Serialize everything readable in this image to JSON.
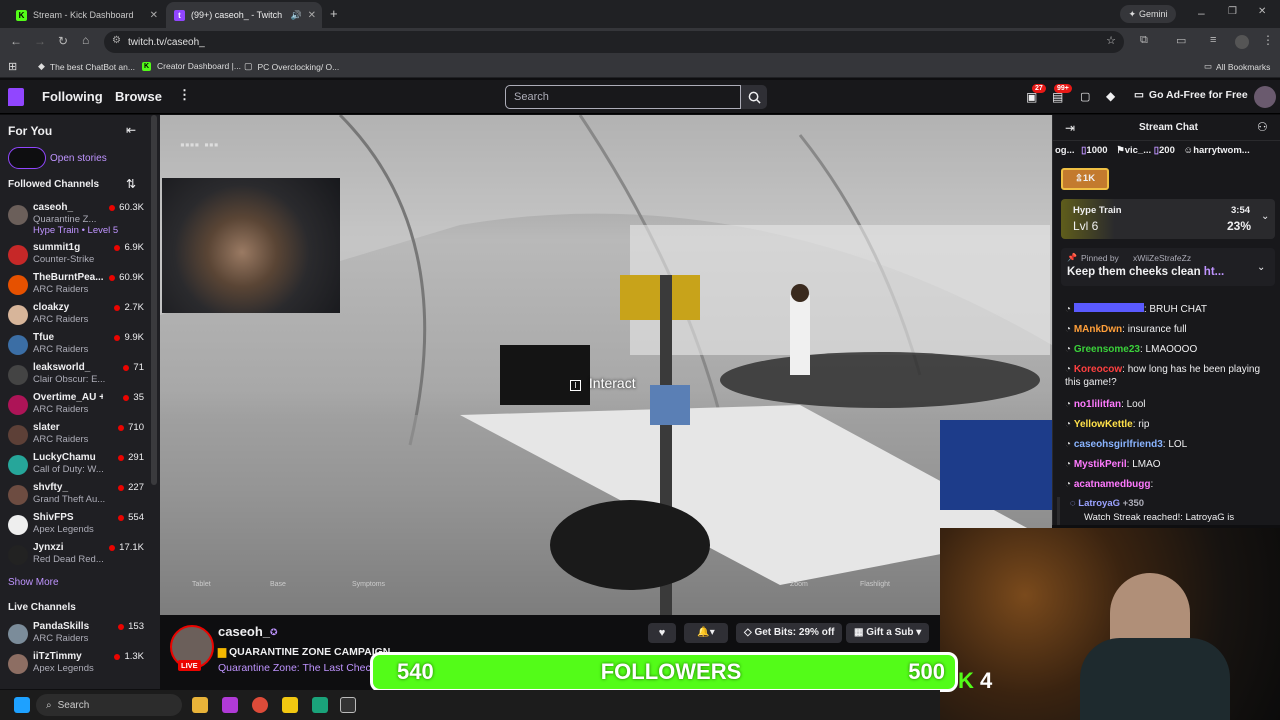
{
  "browser": {
    "tabs": [
      {
        "label": "Stream - Kick Dashboard",
        "active": false
      },
      {
        "label": "(99+) caseoh_ - Twitch",
        "active": true
      }
    ],
    "new_tab": "+",
    "gemini": "Gemini",
    "url": "twitch.tv/caseoh_",
    "bookmarks": [
      "The best ChatBot an...",
      "Creator Dashboard |...",
      "PC Overclocking/ O..."
    ],
    "all_bookmarks": "All Bookmarks"
  },
  "twitch_nav": {
    "following": "Following",
    "browse": "Browse",
    "search_placeholder": "Search",
    "inbox_badge": "27",
    "notifications_badge": "99+",
    "ad_free": "Go Ad-Free for Free"
  },
  "sidebar": {
    "for_you": "For You",
    "open_stories": "Open stories",
    "followed_channels": "Followed Channels",
    "channels": [
      {
        "name": "caseoh_",
        "game": "Quarantine Z...",
        "viewers": "60.3K",
        "extra": "Hype Train • Level 5",
        "color": "#6b5f5a"
      },
      {
        "name": "summit1g",
        "game": "Counter-Strike",
        "viewers": "6.9K",
        "color": "#c62828"
      },
      {
        "name": "TheBurntPea...",
        "game": "ARC Raiders",
        "viewers": "60.9K",
        "color": "#e65100"
      },
      {
        "name": "cloakzy",
        "game": "ARC Raiders",
        "viewers": "2.7K",
        "color": "#d7b59a"
      },
      {
        "name": "Tfue",
        "game": "ARC Raiders",
        "viewers": "9.9K",
        "color": "#3b6ea5"
      },
      {
        "name": "leaksworld_",
        "game": "Clair Obscur: E...",
        "viewers": "71",
        "color": "#444"
      },
      {
        "name": "Overtime_AU +1",
        "game": "ARC Raiders",
        "viewers": "35",
        "color": "#ad1457"
      },
      {
        "name": "slater",
        "game": "ARC Raiders",
        "viewers": "710",
        "color": "#5d4037"
      },
      {
        "name": "LuckyChamu",
        "game": "Call of Duty: W...",
        "viewers": "291",
        "color": "#26a69a"
      },
      {
        "name": "shvfty_",
        "game": "Grand Theft Au...",
        "viewers": "227",
        "color": "#6d4c41"
      },
      {
        "name": "ShivFPS",
        "game": "Apex Legends",
        "viewers": "554",
        "color": "#eee"
      },
      {
        "name": "Jynxzi",
        "game": "Red Dead Red...",
        "viewers": "17.1K",
        "color": "#222"
      }
    ],
    "show_more": "Show More",
    "live_channels": "Live Channels",
    "live": [
      {
        "name": "PandaSkills",
        "game": "ARC Raiders",
        "viewers": "153",
        "color": "#7b8c9a"
      },
      {
        "name": "iiTzTimmy",
        "game": "Apex Legends",
        "viewers": "1.3K",
        "color": "#8d6e63"
      }
    ]
  },
  "video": {
    "interact_prompt": "Interact",
    "hud": [
      "Tablet",
      "Base",
      "Symptoms",
      "Zoom",
      "Flashlight"
    ]
  },
  "streamer": {
    "name": "caseoh_",
    "live_badge": "LIVE",
    "title": "QUARANTINE ZONE CAMPAIGN",
    "category": "Quarantine Zone: The Last Check",
    "get_bits": "Get Bits: 29% off",
    "gift_sub": "Gift a Sub"
  },
  "chat": {
    "header": "Stream Chat",
    "leaderboard": [
      {
        "name": "og...",
        "value": ""
      },
      {
        "name": "",
        "value": "1000"
      },
      {
        "name": "vic_...",
        "value": "200"
      },
      {
        "name": "harrytwom...",
        "value": ""
      }
    ],
    "bits_badge": "1K",
    "hype_train": {
      "label": "Hype Train",
      "level": "Lvl 6",
      "time": "3:54",
      "percent": "23%"
    },
    "pinned": {
      "by": "Pinned by",
      "user": "xWiiZeStrafeZz",
      "text": "Keep them cheeks clean",
      "link": "ht..."
    },
    "messages": [
      {
        "user": "",
        "text": "BRUH CHAT",
        "color": "#5a5aff"
      },
      {
        "user": "MAnkDwn",
        "text": "insurance full",
        "color": "#ff9f3a"
      },
      {
        "user": "Greensome23",
        "text": "LMAOOOO",
        "color": "#3ad13a"
      },
      {
        "user": "Koreocow",
        "text": "how long has he been playing this game!?",
        "color": "#ff4040"
      },
      {
        "user": "no1lilitfan",
        "text": "Lool",
        "color": "#ff7aff"
      },
      {
        "user": "YellowKettle",
        "text": "rip",
        "color": "#ffe14a"
      },
      {
        "user": "caseohsgirlfriend3",
        "text": "LOL",
        "color": "#8ab4ff"
      },
      {
        "user": "MystikPeril",
        "text": "LMAO",
        "color": "#ff7aff"
      },
      {
        "user": "acatnamedbugg",
        "text": "",
        "color": "#ff7aff"
      }
    ],
    "watch_streak": {
      "user": "LatroyaG",
      "points": "+350",
      "text": "Watch Streak reached!: LatroyaG is"
    }
  },
  "overlay": {
    "followers_current": "540",
    "followers_label": "FOLLOWERS",
    "followers_goal": "500",
    "kick_count": "4"
  },
  "taskbar": {
    "search": "Search"
  }
}
